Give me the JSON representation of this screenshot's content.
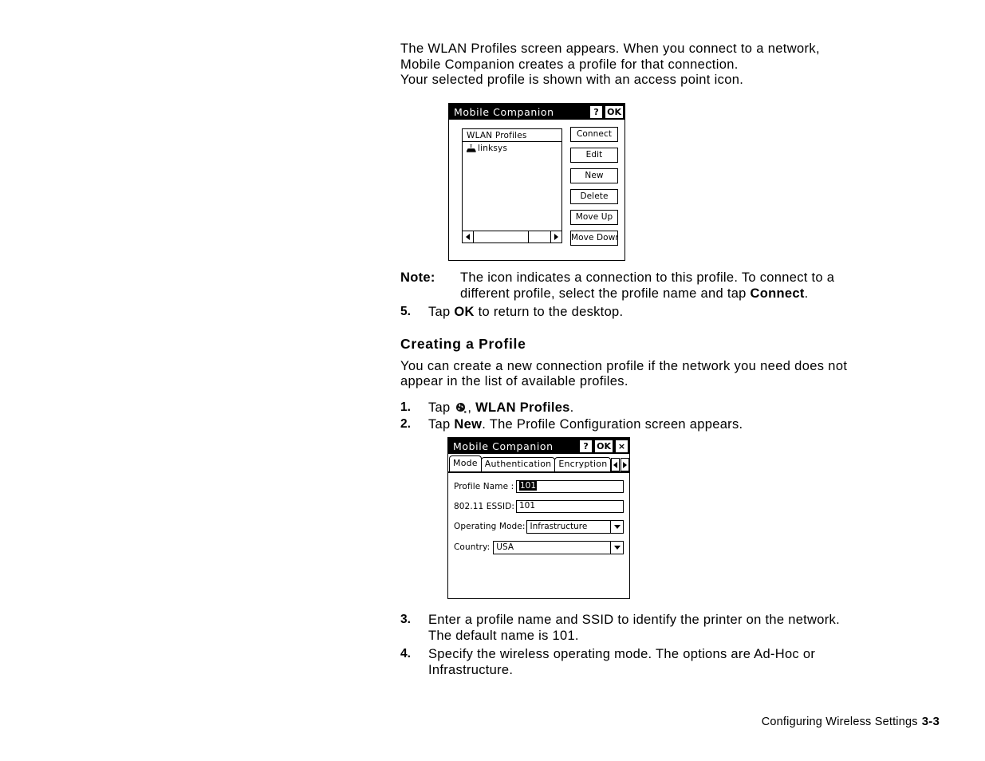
{
  "intro": {
    "line1": "The WLAN Profiles screen appears. When you connect to a network,",
    "line2": "Mobile Companion creates a profile for that connection.",
    "line3": "Your selected profile is shown with an access point icon."
  },
  "profiles_dialog": {
    "title": "Mobile Companion",
    "help_button": "?",
    "ok_button": "OK",
    "list_header": "WLAN Profiles",
    "list_items": [
      {
        "icon": "access-point-icon",
        "label": "linksys"
      }
    ],
    "buttons": [
      "Connect",
      "Edit",
      "New",
      "Delete",
      "Move Up",
      "Move Down"
    ],
    "scrollbar": {
      "left_arrow": "left-arrow-icon",
      "right_arrow": "right-arrow-icon"
    }
  },
  "note": {
    "label": "Note:",
    "text_part1": "The icon indicates a connection to this profile. To connect to a",
    "text_part2": "different profile, select the profile name and tap ",
    "bold_term": "Connect",
    "text_part3": "."
  },
  "step5": {
    "number": "5.",
    "pre": "Tap ",
    "bold": "OK",
    "post": " to return to the desktop."
  },
  "section": {
    "heading": "Creating a Profile",
    "body_line1": "You can create a new connection profile if the network you need does not",
    "body_line2": "appear in the list of available profiles."
  },
  "step1": {
    "number": "1.",
    "pre": "Tap ",
    "icon": "wlan-profiles-icon",
    "mid": ", ",
    "bold": "WLAN Profiles",
    "post": "."
  },
  "step2": {
    "number": "2.",
    "pre": "Tap ",
    "bold": "New",
    "post": ". The Profile Configuration screen appears."
  },
  "config_dialog": {
    "title": "Mobile Companion",
    "help_button": "?",
    "ok_button": "OK",
    "close_button": "×",
    "tabs": [
      {
        "label": "Mode",
        "active": true
      },
      {
        "label": "Authentication",
        "active": false
      },
      {
        "label": "Encryption",
        "active": false
      }
    ],
    "tab_scroll_left": "left-arrow-icon",
    "tab_scroll_right": "right-arrow-icon",
    "fields": {
      "profile_name_label": "Profile Name :",
      "profile_name_value": "101",
      "essid_label": "802.11 ESSID:",
      "essid_value": "101",
      "operating_mode_label": "Operating Mode:",
      "operating_mode_value": "Infrastructure",
      "country_label": "Country:",
      "country_value": "USA"
    }
  },
  "step3": {
    "number": "3.",
    "line1": "Enter a profile name and SSID to identify the printer on the network.",
    "line2": "The default name is 101."
  },
  "step4": {
    "number": "4.",
    "line1": "Specify the wireless operating mode. The options are Ad-Hoc or",
    "line2": "Infrastructure."
  },
  "footer": {
    "text": "Configuring Wireless Settings",
    "page": "3-3"
  }
}
